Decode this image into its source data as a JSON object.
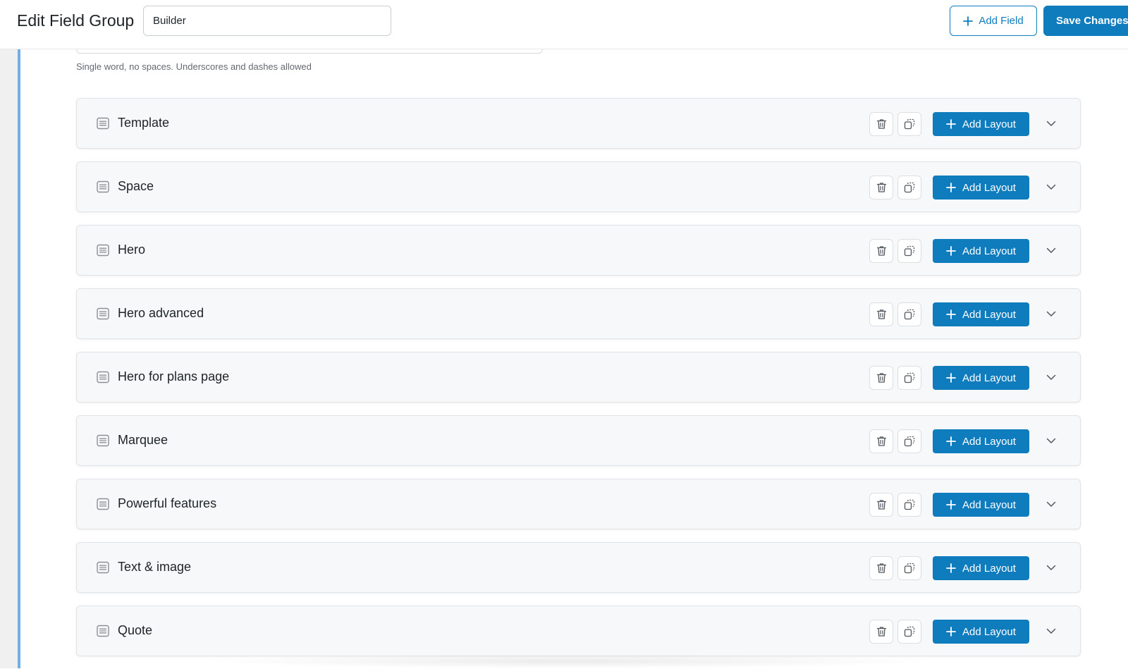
{
  "header": {
    "title": "Edit Field Group",
    "title_input_value": "Builder",
    "add_field_label": "Add Field",
    "save_label": "Save Changes"
  },
  "field": {
    "hint": "Single word, no spaces. Underscores and dashes allowed"
  },
  "layouts": {
    "add_layout_label": "Add Layout",
    "items": [
      {
        "label": "Template"
      },
      {
        "label": "Space"
      },
      {
        "label": "Hero"
      },
      {
        "label": "Hero advanced"
      },
      {
        "label": "Hero for plans page"
      },
      {
        "label": "Marquee"
      },
      {
        "label": "Powerful features"
      },
      {
        "label": "Text & image"
      },
      {
        "label": "Quote"
      }
    ]
  },
  "icons": {
    "row": "list-icon",
    "trash": "trash-icon",
    "duplicate": "duplicate-icon",
    "add": "plus-icon",
    "expand": "chevron-down-icon"
  },
  "colors": {
    "accent": "#0f7cbe",
    "left_bar": "#72aee6"
  }
}
